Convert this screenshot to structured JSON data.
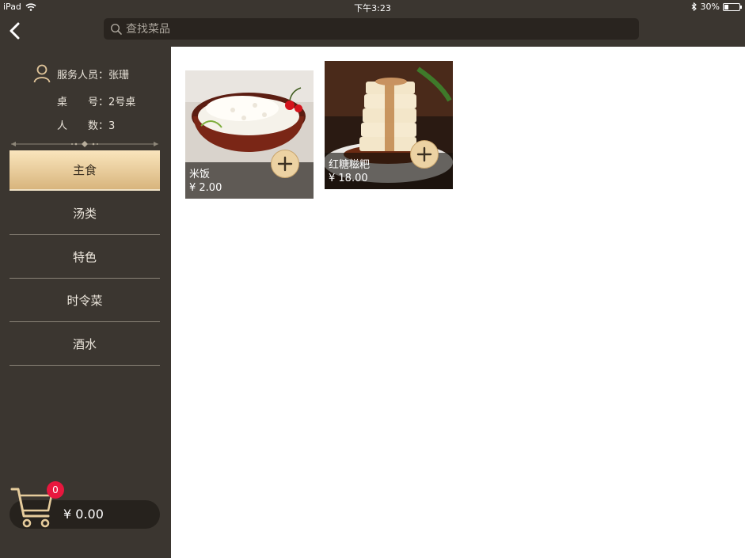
{
  "status_bar": {
    "device": "iPad",
    "time": "下午3:23",
    "battery": "30%",
    "battery_level": 0.3
  },
  "search": {
    "placeholder": "查找菜品"
  },
  "sidebar": {
    "staff_label": "服务人员：",
    "staff_name": "张珊",
    "table_label": "桌　　号：",
    "table_value": "2号桌",
    "guests_label": "人　　数：",
    "guests_value": "3",
    "categories": [
      {
        "label": "主食",
        "active": true
      },
      {
        "label": "汤类",
        "active": false
      },
      {
        "label": "特色",
        "active": false
      },
      {
        "label": "时令菜",
        "active": false
      },
      {
        "label": "酒水",
        "active": false
      }
    ],
    "cart": {
      "count": "0",
      "total": "¥ 0.00"
    }
  },
  "dishes": [
    {
      "name": "米饭",
      "price": "¥ 2.00"
    },
    {
      "name": "红糖糍粑",
      "price": "¥ 18.00"
    }
  ],
  "colors": {
    "chrome": "#3b3630",
    "accent_gold": "#d8b57d",
    "badge_red": "#e8173e"
  }
}
